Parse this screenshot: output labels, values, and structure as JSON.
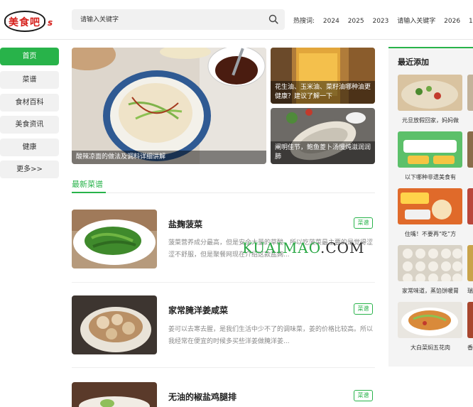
{
  "header": {
    "logo_text": "美食吧",
    "logo_suffix": "s",
    "search_placeholder": "请输入关键字",
    "hot_label": "热搜词:",
    "hot_words": [
      "2024",
      "2025",
      "2023",
      "请输入关键字",
      "2026",
      "1"
    ]
  },
  "sidebar": {
    "items": [
      {
        "label": "首页",
        "active": true
      },
      {
        "label": "菜谱",
        "active": false
      },
      {
        "label": "食材百科",
        "active": false
      },
      {
        "label": "美食资讯",
        "active": false
      },
      {
        "label": "健康",
        "active": false
      },
      {
        "label": "更多>>",
        "active": false
      }
    ]
  },
  "hero": {
    "main_caption": "酸辣凉面的做法及调料详细讲解",
    "side": [
      {
        "caption": "花生油、玉米油、菜籽油哪种油更健康？建议了解一下"
      },
      {
        "caption": "阐明佳节，鲍鱼菱卜汤慢炖滋润润肺"
      }
    ]
  },
  "latest": {
    "title": "最新菜谱",
    "items": [
      {
        "title": "盐麹菠菜",
        "desc": "菠菜营养成分最高，但是安全大量的草酸，所以吃菠菜最主要的是觉得涩涩不舒服，但是聚餐网现在介绍这款盐麹...",
        "tag": "菜谱"
      },
      {
        "title": "家常腌洋姜咸菜",
        "desc": "姜可以去寒去腥，是我们生活中少不了的调味菜，姜的价格比较高。所以我经常在便宜的时候多买些洋姜做腌洋姜...",
        "tag": "菜谱"
      },
      {
        "title": "无油的椒盐鸡腿排",
        "desc": "",
        "tag": "菜谱"
      }
    ]
  },
  "watermark": {
    "part1": "KUAIMAO",
    "part2": ".COM"
  },
  "panel": {
    "title": "最近添加",
    "items": [
      {
        "caption": "元旦放假回家，妈妈做"
      },
      {
        "caption": "以下哪种非遗美食有"
      },
      {
        "caption": "住嘴！不要再“吃”方"
      },
      {
        "caption": "家常味道，蒸馅饼暖胃"
      },
      {
        "caption": "大白菜焖五花肉"
      }
    ],
    "partial_captions": [
      "",
      "",
      "",
      "瑞",
      "香"
    ]
  },
  "colors": {
    "accent": "#28b34a",
    "brand": "#d6201c"
  }
}
